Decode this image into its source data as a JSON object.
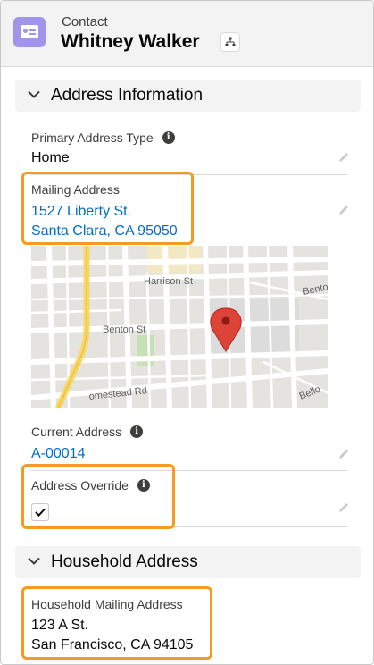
{
  "header": {
    "object_type": "Contact",
    "record_name": "Whitney Walker"
  },
  "sections": {
    "address_information": {
      "title": "Address Information"
    },
    "household_address": {
      "title": "Household Address"
    }
  },
  "fields": {
    "primary_address_type": {
      "label": "Primary Address Type",
      "value": "Home"
    },
    "mailing_address": {
      "label": "Mailing Address",
      "line1": "1527 Liberty St.",
      "line2": "Santa Clara, CA 95050"
    },
    "current_address": {
      "label": "Current Address",
      "value": "A-00014"
    },
    "address_override": {
      "label": "Address Override",
      "checked": true
    },
    "household_mailing_address": {
      "label": "Household Mailing Address",
      "line1": "123 A St.",
      "line2": "San Francisco, CA 94105"
    }
  },
  "map": {
    "street_labels": [
      "Harrison St",
      "Benton St",
      "Bento",
      "omestead Rd",
      "Bello"
    ]
  },
  "colors": {
    "highlight": "#f59a23",
    "link": "#006dcc",
    "contact_icon": "#a094ed",
    "map_pin": "#db4437"
  },
  "icons": {
    "contact": "contact-card-icon",
    "hierarchy": "hierarchy-icon",
    "info": "info-icon",
    "edit": "pencil-icon",
    "collapse": "chevron-down-icon",
    "pin": "map-pin-icon",
    "check": "checkmark-icon"
  }
}
